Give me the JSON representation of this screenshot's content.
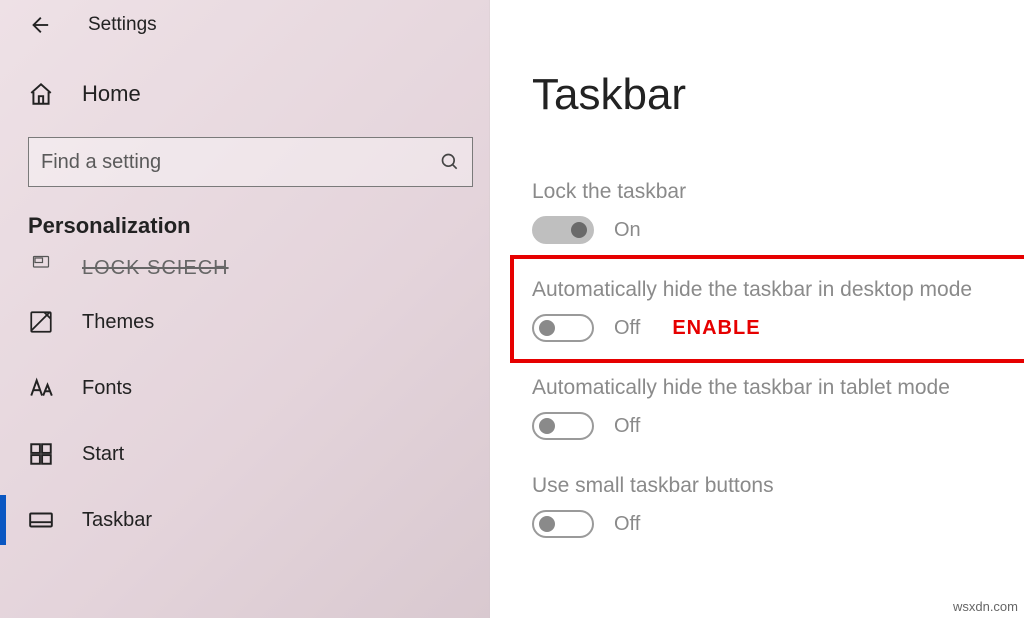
{
  "header": {
    "title": "Settings"
  },
  "home_label": "Home",
  "search": {
    "placeholder": "Find a setting"
  },
  "section_title": "Personalization",
  "nav": {
    "lock_screen": "LOCK SCIECH",
    "themes": "Themes",
    "fonts": "Fonts",
    "start": "Start",
    "taskbar": "Taskbar"
  },
  "page": {
    "title": "Taskbar",
    "settings": {
      "lock": {
        "label": "Lock the taskbar",
        "state": "On",
        "on": true
      },
      "hide_desktop": {
        "label": "Automatically hide the taskbar in desktop mode",
        "state": "Off",
        "on": false
      },
      "hide_tablet": {
        "label": "Automatically hide the taskbar in tablet mode",
        "state": "Off",
        "on": false
      },
      "small_buttons": {
        "label": "Use small taskbar buttons",
        "state": "Off",
        "on": false
      }
    },
    "annotation": "ENABLE"
  },
  "watermark": "wsxdn.com"
}
